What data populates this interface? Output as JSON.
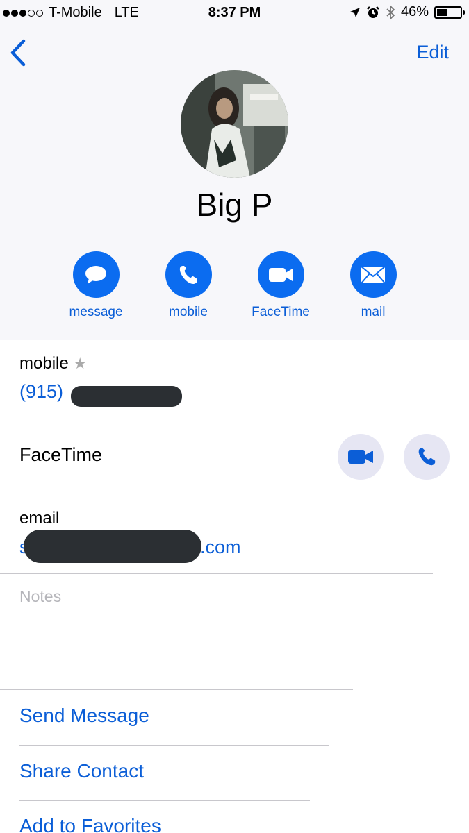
{
  "status_bar": {
    "carrier": "T-Mobile",
    "network": "LTE",
    "time": "8:37 PM",
    "battery_percent_label": "46%",
    "battery_level": 0.46,
    "signal_bars_filled": 3,
    "signal_bars_total": 5
  },
  "nav": {
    "back_icon": "chevron-left-icon",
    "edit_label": "Edit"
  },
  "contact": {
    "name": "Big P"
  },
  "actions": [
    {
      "label": "message",
      "icon": "message-bubble-icon"
    },
    {
      "label": "mobile",
      "icon": "phone-icon"
    },
    {
      "label": "FaceTime",
      "icon": "video-camera-icon"
    },
    {
      "label": "mail",
      "icon": "envelope-icon"
    }
  ],
  "phone": {
    "label": "mobile",
    "star": "★",
    "number_visible": "(915)"
  },
  "facetime": {
    "label": "FaceTime"
  },
  "email": {
    "label": "email",
    "value_prefix": "s",
    "value_suffix": ".com"
  },
  "notes": {
    "placeholder": "Notes"
  },
  "links": {
    "send_message": "Send Message",
    "share_contact": "Share Contact",
    "add_to_favorites": "Add to Favorites"
  },
  "colors": {
    "accent": "#0b5ed7",
    "action_fill": "#0b6cf0",
    "header_bg": "#f7f7fa"
  }
}
